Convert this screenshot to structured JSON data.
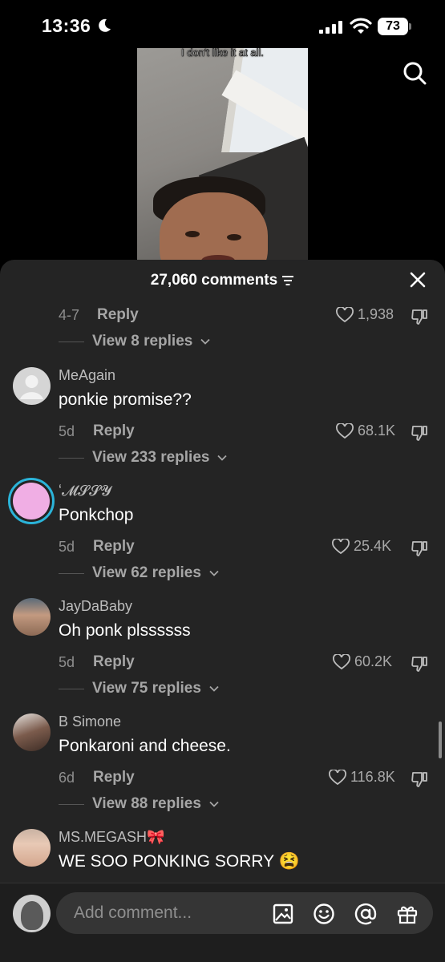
{
  "status_bar": {
    "time": "13:36",
    "battery": "73"
  },
  "video": {
    "caption": "I don't like it at all."
  },
  "comments_sheet": {
    "count_label": "27,060 comments",
    "partial_comment": {
      "date": "4-7",
      "reply_label": "Reply",
      "likes": "1,938",
      "view_replies": "View 8 replies"
    },
    "comments": [
      {
        "username": "MeAgain",
        "text": "ponkie promise??",
        "date": "5d",
        "reply_label": "Reply",
        "likes": "68.1K",
        "view_replies": "View 233 replies"
      },
      {
        "username": "ʻ𝓜𝓢𝓢𝓨",
        "text": "Ponkchop",
        "date": "5d",
        "reply_label": "Reply",
        "likes": "25.4K",
        "view_replies": "View 62 replies"
      },
      {
        "username": "JayDaBaby",
        "text": "Oh ponk plssssss",
        "date": "5d",
        "reply_label": "Reply",
        "likes": "60.2K",
        "view_replies": "View 75 replies"
      },
      {
        "username": "B Simone",
        "text": "Ponkaroni and cheese.",
        "date": "6d",
        "reply_label": "Reply",
        "likes": "116.8K",
        "view_replies": "View 88 replies"
      },
      {
        "username": "MS.MEGASH🎀",
        "text": "WE SOO PONKING SORRY 😫"
      }
    ]
  },
  "input": {
    "placeholder": "Add comment..."
  },
  "icons": [
    "moon-icon",
    "signal-icon",
    "wifi-icon",
    "search-icon",
    "sort-icon",
    "close-icon",
    "heart-icon",
    "dislike-icon",
    "chevron-down-icon",
    "image-icon",
    "emoji-icon",
    "mention-icon",
    "gift-icon"
  ]
}
